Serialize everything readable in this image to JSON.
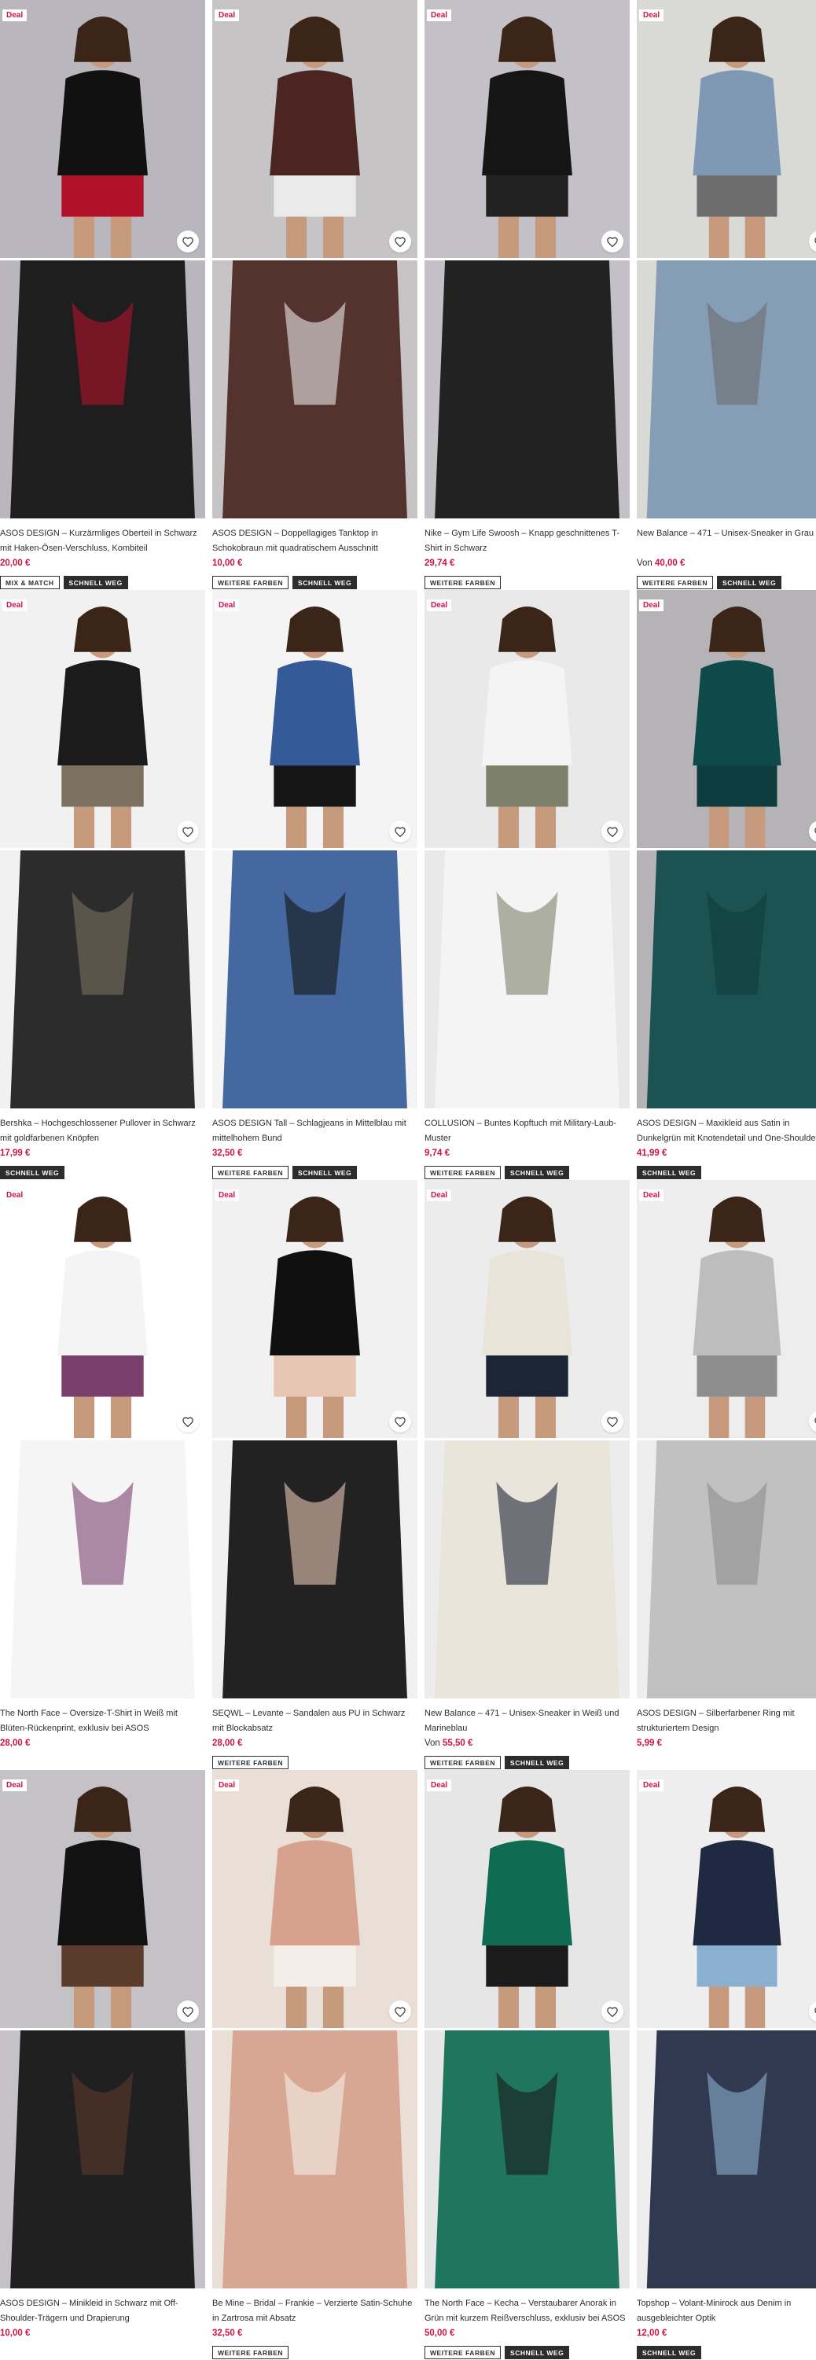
{
  "products": [
    {
      "deal": "Deal",
      "title": "ASOS DESIGN – Kurzärmliges Oberteil in Schwarz mit Haken-Ösen-Verschluss, Kombiteil",
      "price_from": "",
      "price": "20,00 €",
      "tags": [
        "MIX & MATCH",
        "SCHNELL WEG"
      ],
      "bg": "#b9b6bd",
      "figure": "#111111",
      "accent": "#b2112a"
    },
    {
      "deal": "Deal",
      "title": "ASOS DESIGN – Doppellagiges Tanktop in Schokobraun mit quadratischem Ausschnitt",
      "price_from": "",
      "price": "10,00 €",
      "tags": [
        "WEITERE FARBEN",
        "SCHNELL WEG"
      ],
      "bg": "#c7c4c6",
      "figure": "#4a2521",
      "accent": "#eaeaea"
    },
    {
      "deal": "Deal",
      "title": "Nike – Gym Life Swoosh – Knapp geschnittenes T-Shirt in Schwarz",
      "price_from": "",
      "price": "29,74 €",
      "tags": [
        "WEITERE FARBEN"
      ],
      "bg": "#c3c1c7",
      "figure": "#151515",
      "accent": "#222222"
    },
    {
      "deal": "Deal",
      "title": "New Balance – 471 – Unisex-Sneaker in Grau",
      "price_from": "Von",
      "price": "40,00 €",
      "tags": [
        "WEITERE FARBEN",
        "SCHNELL WEG"
      ],
      "bg": "#d9d9d6",
      "figure": "#7f98b3",
      "accent": "#6d6d6d"
    },
    {
      "deal": "Deal",
      "title": "Bershka – Hochgeschlossener Pullover in Schwarz mit goldfarbenen Knöpfen",
      "price_from": "",
      "price": "17,99 €",
      "tags": [
        "SCHNELL WEG"
      ],
      "bg": "#f1f1f1",
      "figure": "#1b1b1b",
      "accent": "#7a7160"
    },
    {
      "deal": "Deal",
      "title": "ASOS DESIGN Tall – Schlagjeans in Mittelblau mit mittelhohem Bund",
      "price_from": "",
      "price": "32,50 €",
      "tags": [
        "WEITERE FARBEN",
        "SCHNELL WEG"
      ],
      "bg": "#f4f4f4",
      "figure": "#345b97",
      "accent": "#161616"
    },
    {
      "deal": "Deal",
      "title": "COLLUSION – Buntes Kopftuch mit Military-Laub-Muster",
      "price_from": "",
      "price": "9,74 €",
      "tags": [
        "WEITERE FARBEN",
        "SCHNELL WEG"
      ],
      "bg": "#e9e9e9",
      "figure": "#f4f4f4",
      "accent": "#7d806a"
    },
    {
      "deal": "Deal",
      "title": "ASOS DESIGN – Maxikleid aus Satin in Dunkelgrün mit Knotendetail und One-Shoulder-Träger",
      "price_from": "",
      "price": "41,99 €",
      "tags": [
        "SCHNELL WEG"
      ],
      "bg": "#b6b3b6",
      "figure": "#0f4a4a",
      "accent": "#0d3d3e"
    },
    {
      "deal": "Deal",
      "title": "The North Face – Oversize-T-Shirt in Weiß mit Blüten-Rückenprint, exklusiv bei ASOS",
      "price_from": "",
      "price": "28,00 €",
      "tags": [],
      "bg": "#ffffff",
      "figure": "#f4f4f4",
      "accent": "#7a3f6d"
    },
    {
      "deal": "Deal",
      "title": "SEQWL – Levante – Sandalen aus PU in Schwarz mit Blockabsatz",
      "price_from": "",
      "price": "28,00 €",
      "tags": [
        "WEITERE FARBEN"
      ],
      "bg": "#f1f1f1",
      "figure": "#101010",
      "accent": "#e7c6b3"
    },
    {
      "deal": "Deal",
      "title": "New Balance – 471 – Unisex-Sneaker in Weiß und Marineblau",
      "price_from": "Von",
      "price": "55,50 €",
      "tags": [
        "WEITERE FARBEN",
        "SCHNELL WEG"
      ],
      "bg": "#ececec",
      "figure": "#e8e4d9",
      "accent": "#1c2536"
    },
    {
      "deal": "Deal",
      "title": "ASOS DESIGN – Silberfarbener Ring mit strukturiertem Design",
      "price_from": "",
      "price": "5,99 €",
      "tags": [],
      "bg": "#ededed",
      "figure": "#bdbdbd",
      "accent": "#8e8e8e"
    },
    {
      "deal": "Deal",
      "title": "ASOS DESIGN – Minikleid in Schwarz mit Off-Shoulder-Trägern und Drapierung",
      "price_from": "",
      "price": "10,00 €",
      "tags": [],
      "bg": "#c4c2c6",
      "figure": "#121212",
      "accent": "#5b3b2c"
    },
    {
      "deal": "Deal",
      "title": "Be Mine – Bridal – Frankie – Verzierte Satin-Schuhe in Zartrosa mit Absatz",
      "price_from": "",
      "price": "32,50 €",
      "tags": [
        "WEITERE FARBEN"
      ],
      "bg": "#eadfd6",
      "figure": "#d6a28d",
      "accent": "#f4eee8"
    },
    {
      "deal": "Deal",
      "title": "The North Face – Kecha – Verstaubarer Anorak in Grün mit kurzem Reißverschluss, exklusiv bei ASOS",
      "price_from": "",
      "price": "50,00 €",
      "tags": [
        "WEITERE FARBEN",
        "SCHNELL WEG"
      ],
      "bg": "#e6e6e6",
      "figure": "#0f6b52",
      "accent": "#1b1b1b"
    },
    {
      "deal": "Deal",
      "title": "Topshop – Volant-Minirock aus Denim in ausgebleichter Optik",
      "price_from": "",
      "price": "12,00 €",
      "tags": [
        "SCHNELL WEG"
      ],
      "bg": "#eeeeee",
      "figure": "#1f2941",
      "accent": "#8bb0cf"
    }
  ]
}
